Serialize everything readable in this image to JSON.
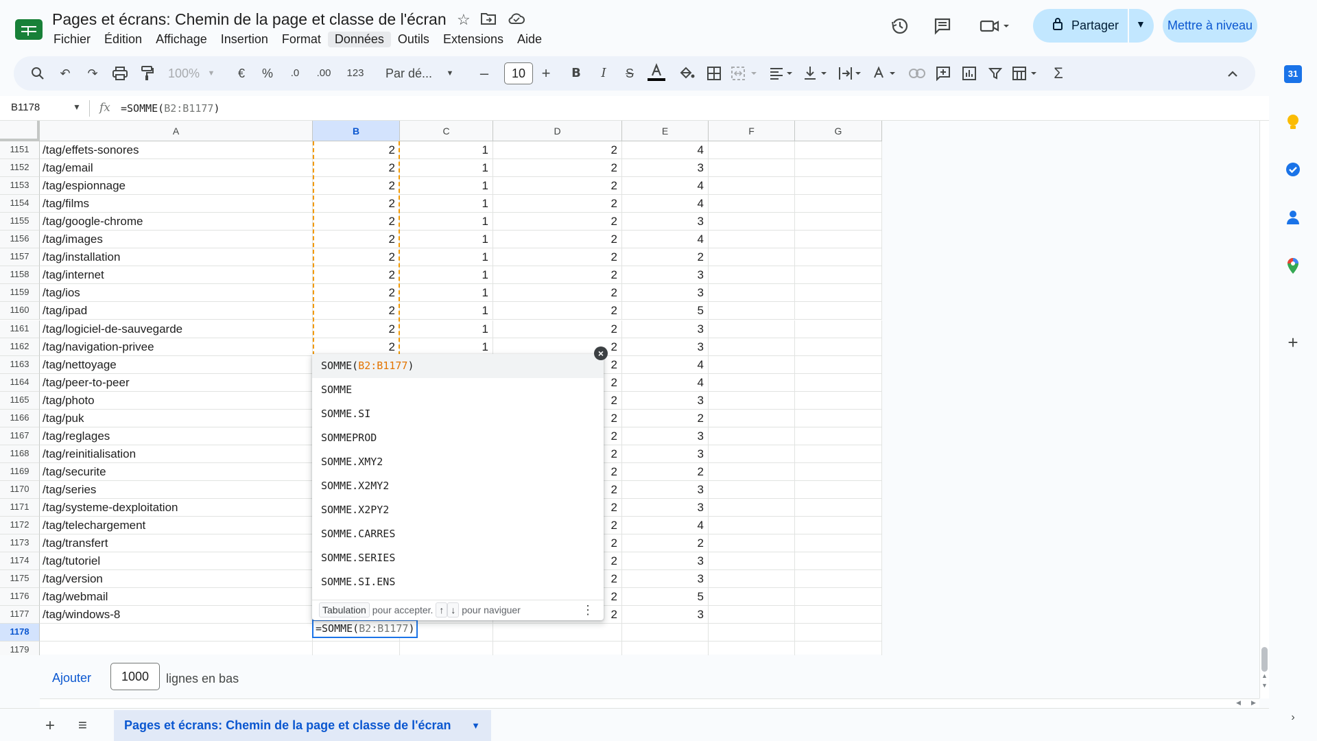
{
  "header": {
    "doc_title": "Pages et écrans: Chemin de la page et classe de l'écran",
    "menus": [
      "Fichier",
      "Édition",
      "Affichage",
      "Insertion",
      "Format",
      "Données",
      "Outils",
      "Extensions",
      "Aide"
    ],
    "active_menu": "Données",
    "share_label": "Partager",
    "upgrade_label": "Mettre à niveau"
  },
  "toolbar": {
    "zoom": "100%",
    "currency": "€",
    "percent": "%",
    "decimal_decrease": ".0",
    "decimal_increase": ".00",
    "number_format": "123",
    "font_family": "Par dé...",
    "font_size": "10"
  },
  "formula_bar": {
    "cell_ref": "B1178",
    "fn": "=SOMME(",
    "arg": "B2:B1177",
    "close": ")"
  },
  "columns": [
    "A",
    "B",
    "C",
    "D",
    "E",
    "F",
    "G"
  ],
  "rows": [
    {
      "n": "1151",
      "a": "/tag/effets-sonores",
      "b": "2",
      "c": "1",
      "d": "2",
      "e": "4"
    },
    {
      "n": "1152",
      "a": "/tag/email",
      "b": "2",
      "c": "1",
      "d": "2",
      "e": "3"
    },
    {
      "n": "1153",
      "a": "/tag/espionnage",
      "b": "2",
      "c": "1",
      "d": "2",
      "e": "4"
    },
    {
      "n": "1154",
      "a": "/tag/films",
      "b": "2",
      "c": "1",
      "d": "2",
      "e": "4"
    },
    {
      "n": "1155",
      "a": "/tag/google-chrome",
      "b": "2",
      "c": "1",
      "d": "2",
      "e": "3"
    },
    {
      "n": "1156",
      "a": "/tag/images",
      "b": "2",
      "c": "1",
      "d": "2",
      "e": "4"
    },
    {
      "n": "1157",
      "a": "/tag/installation",
      "b": "2",
      "c": "1",
      "d": "2",
      "e": "2"
    },
    {
      "n": "1158",
      "a": "/tag/internet",
      "b": "2",
      "c": "1",
      "d": "2",
      "e": "3"
    },
    {
      "n": "1159",
      "a": "/tag/ios",
      "b": "2",
      "c": "1",
      "d": "2",
      "e": "3"
    },
    {
      "n": "1160",
      "a": "/tag/ipad",
      "b": "2",
      "c": "1",
      "d": "2",
      "e": "5"
    },
    {
      "n": "1161",
      "a": "/tag/logiciel-de-sauvegarde",
      "b": "2",
      "c": "1",
      "d": "2",
      "e": "3"
    },
    {
      "n": "1162",
      "a": "/tag/navigation-privee",
      "b": "2",
      "c": "1",
      "d": "2",
      "e": "3"
    },
    {
      "n": "1163",
      "a": "/tag/nettoyage",
      "b": "",
      "c": "",
      "d": "2",
      "e": "4"
    },
    {
      "n": "1164",
      "a": "/tag/peer-to-peer",
      "b": "",
      "c": "",
      "d": "2",
      "e": "4"
    },
    {
      "n": "1165",
      "a": "/tag/photo",
      "b": "",
      "c": "",
      "d": "2",
      "e": "3"
    },
    {
      "n": "1166",
      "a": "/tag/puk",
      "b": "",
      "c": "",
      "d": "2",
      "e": "2"
    },
    {
      "n": "1167",
      "a": "/tag/reglages",
      "b": "",
      "c": "",
      "d": "2",
      "e": "3"
    },
    {
      "n": "1168",
      "a": "/tag/reinitialisation",
      "b": "",
      "c": "",
      "d": "2",
      "e": "3"
    },
    {
      "n": "1169",
      "a": "/tag/securite",
      "b": "",
      "c": "",
      "d": "2",
      "e": "2"
    },
    {
      "n": "1170",
      "a": "/tag/series",
      "b": "",
      "c": "",
      "d": "2",
      "e": "3"
    },
    {
      "n": "1171",
      "a": "/tag/systeme-dexploitation",
      "b": "",
      "c": "",
      "d": "2",
      "e": "3"
    },
    {
      "n": "1172",
      "a": "/tag/telechargement",
      "b": "",
      "c": "",
      "d": "2",
      "e": "4"
    },
    {
      "n": "1173",
      "a": "/tag/transfert",
      "b": "",
      "c": "",
      "d": "2",
      "e": "2"
    },
    {
      "n": "1174",
      "a": "/tag/tutoriel",
      "b": "",
      "c": "",
      "d": "2",
      "e": "3"
    },
    {
      "n": "1175",
      "a": "/tag/version",
      "b": "",
      "c": "",
      "d": "2",
      "e": "3"
    },
    {
      "n": "1176",
      "a": "/tag/webmail",
      "b": "",
      "c": "",
      "d": "2",
      "e": "5"
    },
    {
      "n": "1177",
      "a": "/tag/windows-8",
      "b": "",
      "c": "",
      "d": "2",
      "e": "3"
    },
    {
      "n": "1178",
      "a": "",
      "b": "",
      "c": "",
      "d": "",
      "e": ""
    },
    {
      "n": "1179",
      "a": "",
      "b": "",
      "c": "",
      "d": "",
      "e": ""
    }
  ],
  "active_cell": {
    "fn": "=SOMME(",
    "arg": "B2:B1177",
    "close": ")"
  },
  "autocomplete": {
    "first": {
      "fn": "SOMME(",
      "arg": "B2:B1177",
      "close": ")"
    },
    "items": [
      "SOMME",
      "SOMME.SI",
      "SOMMEPROD",
      "SOMME.XMY2",
      "SOMME.X2MY2",
      "SOMME.X2PY2",
      "SOMME.CARRES",
      "SOMME.SERIES",
      "SOMME.SI.ENS"
    ],
    "footer_key": "Tabulation",
    "footer_accept": "pour accepter.",
    "footer_up": "↑",
    "footer_down": "↓",
    "footer_nav": "pour naviguer"
  },
  "add_rows": {
    "button": "Ajouter",
    "count": "1000",
    "label": "lignes en bas"
  },
  "sheet_tab": {
    "name": "Pages et écrans: Chemin de la page et classe de l'écran"
  },
  "side_panel": {
    "calendar_day": "31"
  }
}
